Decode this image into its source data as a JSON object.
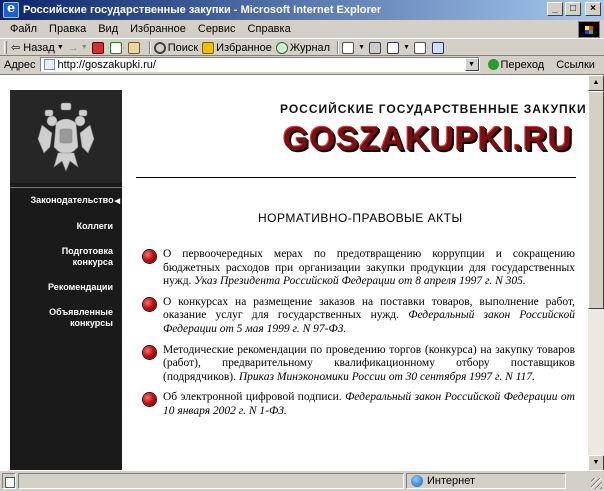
{
  "window": {
    "title": "Российские государственные закупки - Microsoft Internet Explorer",
    "minimize": "_",
    "maximize": "□",
    "close": "×"
  },
  "menu": [
    "Файл",
    "Правка",
    "Вид",
    "Избранное",
    "Сервис",
    "Справка"
  ],
  "toolbar": {
    "back": "Назад",
    "forward": "→",
    "search": "Поиск",
    "favorites": "Избранное",
    "history": "Журнал"
  },
  "address": {
    "label": "Адрес",
    "url": "http://goszakupki.ru/",
    "go": "Переход",
    "links": "Ссылки"
  },
  "site": {
    "header_title": "РОССИЙСКИЕ ГОСУДАРСТВЕННЫЕ ЗАКУПКИ",
    "logo": "GOSZAKUPKI.RU",
    "nav": [
      {
        "label": "Законодательство"
      },
      {
        "label": "Коллеги"
      },
      {
        "label": "Подготовка\nконкурса"
      },
      {
        "label": "Рекомендации"
      },
      {
        "label": "Объявленные\nконкурсы"
      }
    ],
    "section_title": "НОРМАТИВНО-ПРАВОВЫЕ АКТЫ",
    "acts": [
      {
        "title": "О первоочередных мерах по предотвращению коррупции и сокращению бюджетных расходов при организации закупки продукции для государственных нужд.",
        "source": "Указ Президента Российской Федерации от 8 апреля 1997 г. N 305."
      },
      {
        "title": "О конкурсах на размещение заказов на поставки товаров, выполнение работ, оказание услуг для государственных нужд.",
        "source": "Федеральный закон Российской Федерации от 5 мая 1999 г. N 97-ФЗ."
      },
      {
        "title": "Методические рекомендации по проведению торгов (конкурса) на закупку товаров (работ), предварительному квалификационному отбору поставщиков (подрядчиков).",
        "source": "Приказ Минэкономики России от 30 сентября 1997 г. N 117."
      },
      {
        "title": "Об электронной цифровой подписи.",
        "source": "Федеральный закон Российской Федерации от 10 января 2002 г. N 1-ФЗ."
      }
    ]
  },
  "status": {
    "zone": "Интернет"
  }
}
